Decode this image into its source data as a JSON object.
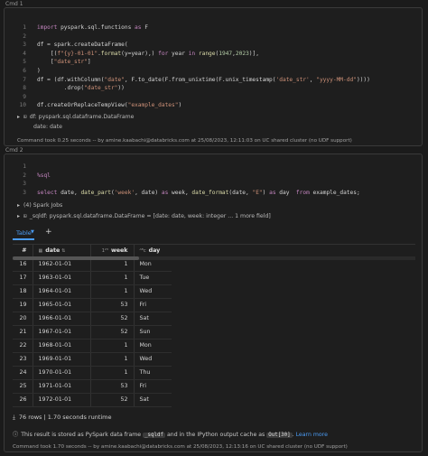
{
  "cell1": {
    "label": "Cmd 1",
    "code": [
      {
        "n": "1",
        "parts": [
          [
            "kw",
            "import"
          ],
          [
            "txt",
            " pyspark.sql.functions "
          ],
          [
            "kw",
            "as"
          ],
          [
            "txt",
            " F"
          ]
        ]
      },
      {
        "n": "2",
        "parts": []
      },
      {
        "n": "3",
        "parts": [
          [
            "txt",
            "df = spark.createDataFrame("
          ]
        ]
      },
      {
        "n": "4",
        "parts": [
          [
            "txt",
            "    [("
          ],
          [
            "str",
            "f\"{y}-01-01\""
          ],
          [
            "txt",
            "."
          ],
          [
            "fn",
            "format"
          ],
          [
            "txt",
            "(y=year),) "
          ],
          [
            "kw",
            "for"
          ],
          [
            "txt",
            " year "
          ],
          [
            "kw",
            "in"
          ],
          [
            "txt",
            " "
          ],
          [
            "fn",
            "range"
          ],
          [
            "txt",
            "("
          ],
          [
            "num",
            "1947"
          ],
          [
            "txt",
            ","
          ],
          [
            "num",
            "2023"
          ],
          [
            "txt",
            ")],"
          ]
        ]
      },
      {
        "n": "5",
        "parts": [
          [
            "txt",
            "    ["
          ],
          [
            "str",
            "\"date_str\""
          ],
          [
            "txt",
            "]"
          ]
        ]
      },
      {
        "n": "6",
        "parts": [
          [
            "txt",
            ")"
          ]
        ]
      },
      {
        "n": "7",
        "parts": [
          [
            "txt",
            "df = (df.withColumn("
          ],
          [
            "str",
            "\"date\""
          ],
          [
            "txt",
            ", F.to_date(F.from_unixtime(F.unix_timestamp("
          ],
          [
            "str",
            "'date_str'"
          ],
          [
            "txt",
            ", "
          ],
          [
            "str",
            "\"yyyy-MM-dd\""
          ],
          [
            "txt",
            "))))"
          ]
        ]
      },
      {
        "n": "8",
        "parts": [
          [
            "txt",
            "        .drop("
          ],
          [
            "str",
            "\"date_str\""
          ],
          [
            "txt",
            "))"
          ]
        ]
      },
      {
        "n": "9",
        "parts": []
      },
      {
        "n": "10",
        "parts": [
          [
            "txt",
            "df.createOrReplaceTempView("
          ],
          [
            "str",
            "\"example_dates\""
          ],
          [
            "txt",
            ")"
          ]
        ]
      }
    ],
    "output_df": "df:  pyspark.sql.dataframe.DataFrame",
    "output_field": "date:  date",
    "footer": "Command took 0.25 seconds -- by amine.kaabachi@databricks.com at 25/08/2023, 12:11:03 on UC shared cluster (no UDF support)"
  },
  "cell2": {
    "label": "Cmd 2",
    "code": [
      {
        "n": "1",
        "parts": []
      },
      {
        "n": "2",
        "parts": [
          [
            "kw",
            "%sql"
          ]
        ]
      },
      {
        "n": "3",
        "parts": []
      },
      {
        "n": "3",
        "parts": [
          [
            "kw",
            "select"
          ],
          [
            "txt",
            " date, "
          ],
          [
            "fn",
            "date_part"
          ],
          [
            "txt",
            "("
          ],
          [
            "str",
            "'week'"
          ],
          [
            "txt",
            ", date) "
          ],
          [
            "kw",
            "as"
          ],
          [
            "txt",
            " week, "
          ],
          [
            "fn",
            "date_format"
          ],
          [
            "txt",
            "(date, "
          ],
          [
            "str",
            "\"E\""
          ],
          [
            "txt",
            ") "
          ],
          [
            "kw",
            "as"
          ],
          [
            "txt",
            " day  "
          ],
          [
            "kw",
            "from"
          ],
          [
            "txt",
            " example_dates;"
          ]
        ]
      }
    ],
    "spark_jobs": "(4) Spark Jobs",
    "sqldf": "_sqldf:  pyspark.sql.dataframe.DataFrame = [date: date, week: integer ... 1 more field]",
    "tab_label": "Table",
    "columns": {
      "idx": "#",
      "date": "date",
      "week": "week",
      "day": "day"
    },
    "rows": [
      [
        "16",
        "1962-01-01",
        "1",
        "Mon"
      ],
      [
        "17",
        "1963-01-01",
        "1",
        "Tue"
      ],
      [
        "18",
        "1964-01-01",
        "1",
        "Wed"
      ],
      [
        "19",
        "1965-01-01",
        "53",
        "Fri"
      ],
      [
        "20",
        "1966-01-01",
        "52",
        "Sat"
      ],
      [
        "21",
        "1967-01-01",
        "52",
        "Sun"
      ],
      [
        "22",
        "1968-01-01",
        "1",
        "Mon"
      ],
      [
        "23",
        "1969-01-01",
        "1",
        "Wed"
      ],
      [
        "24",
        "1970-01-01",
        "1",
        "Thu"
      ],
      [
        "25",
        "1971-01-01",
        "53",
        "Fri"
      ],
      [
        "26",
        "1972-01-01",
        "52",
        "Sat"
      ]
    ],
    "rows_summary": "76 rows  |  1.70 seconds runtime",
    "info_pre": "This result is stored as PySpark data frame ",
    "info_var": "_sqldf",
    "info_mid": " and in the IPython output cache as ",
    "info_cache": "Out[30]",
    "info_link": "Learn more",
    "footer": "Command took 1.70 seconds -- by amine.kaabachi@databricks.com at 25/08/2023, 12:13:16 on UC shared cluster (no UDF support)"
  }
}
